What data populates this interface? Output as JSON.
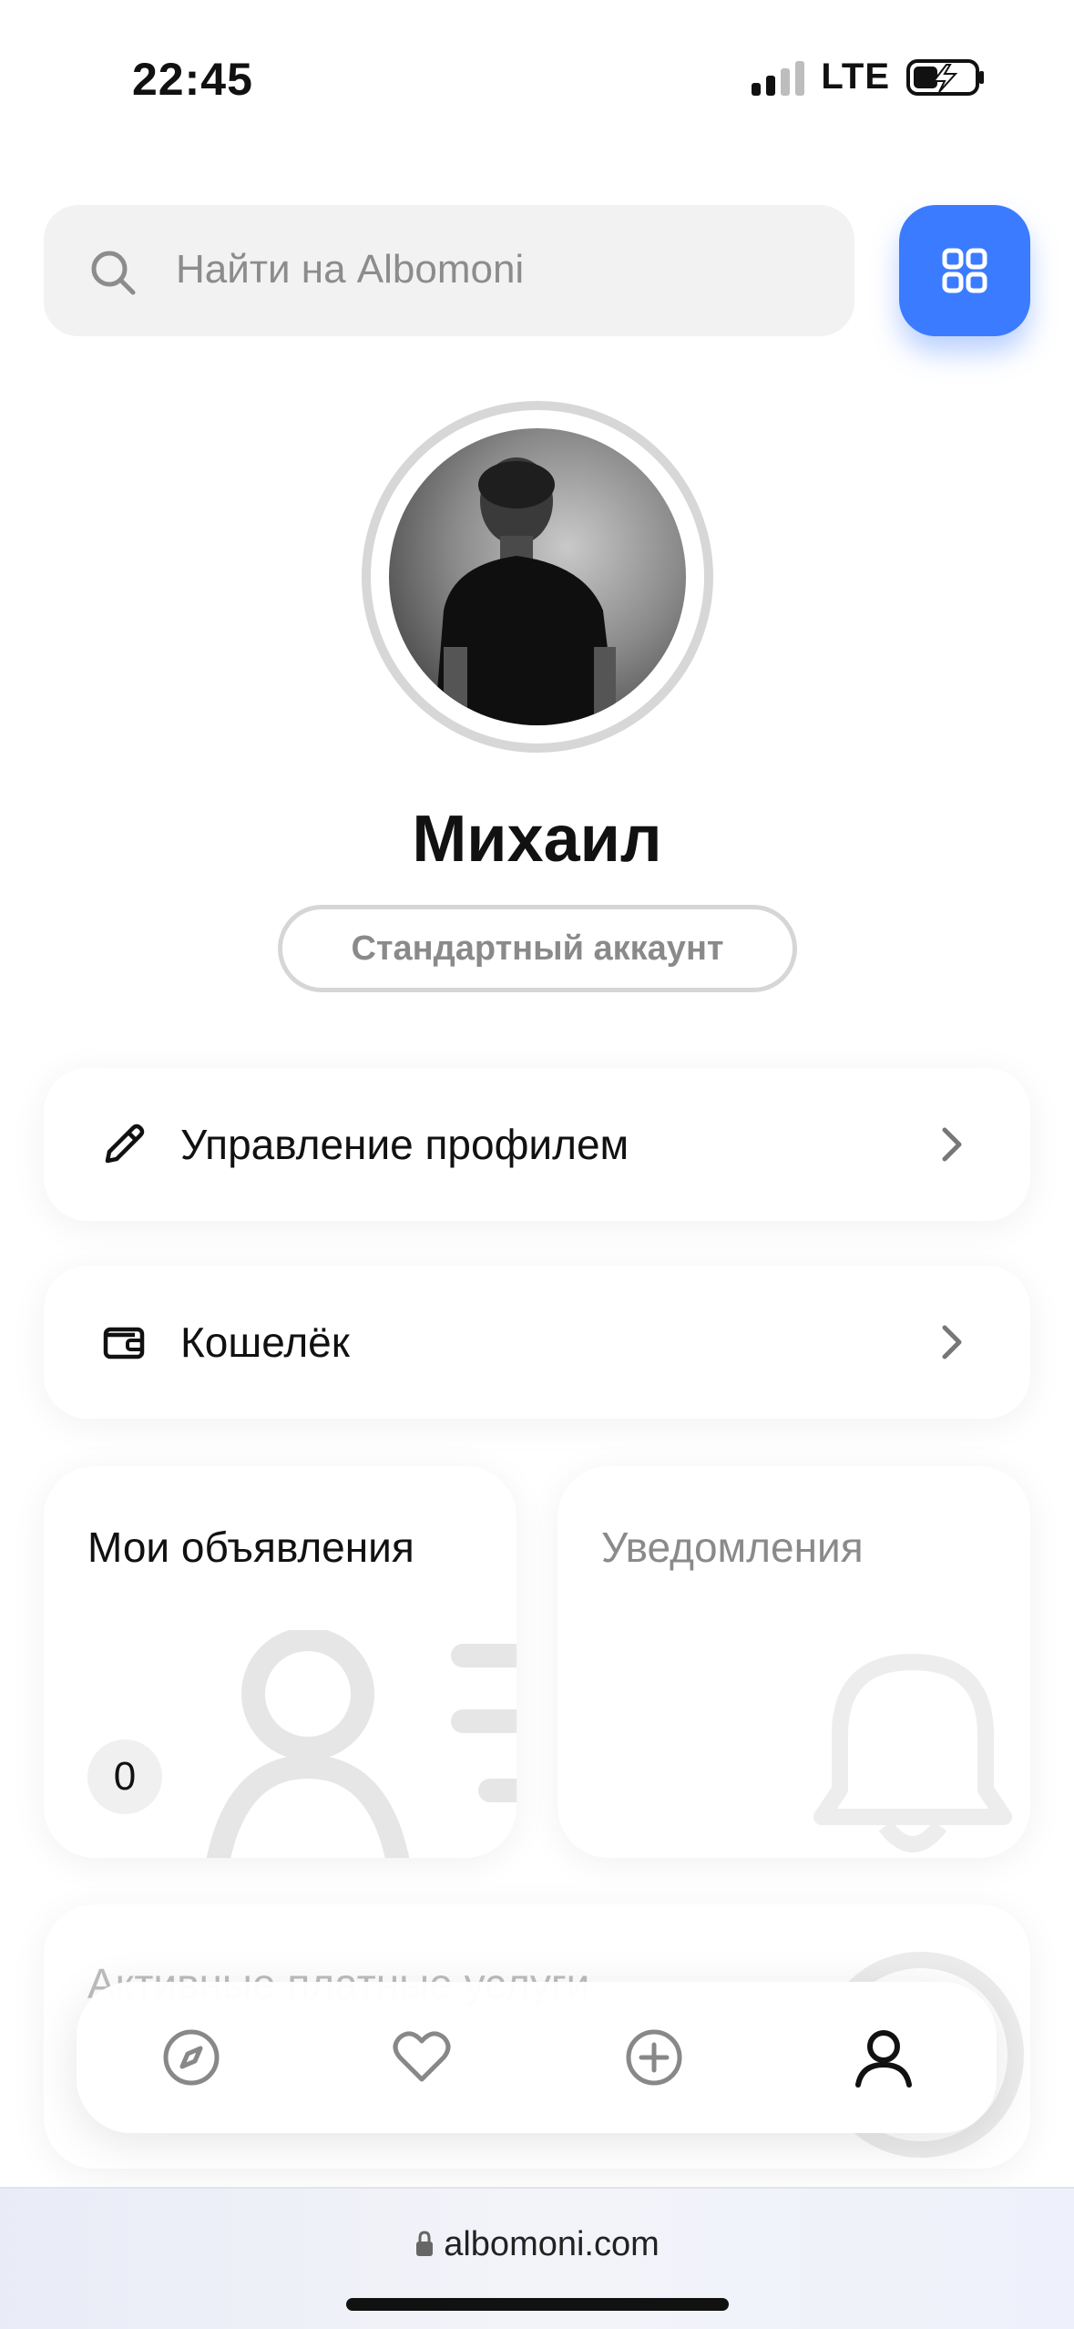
{
  "status": {
    "time": "22:45",
    "network": "LTE"
  },
  "search": {
    "placeholder": "Найти на Albomoni"
  },
  "profile": {
    "name": "Михаил",
    "account_type": "Стандартный аккаунт"
  },
  "menu": [
    {
      "label": "Управление профилем",
      "icon": "pencil-icon"
    },
    {
      "label": "Кошелёк",
      "icon": "wallet-icon"
    }
  ],
  "tiles": {
    "listings": {
      "title": "Мои объявления",
      "count": "0"
    },
    "notifications": {
      "title": "Уведомления"
    }
  },
  "services": {
    "title": "Активные платные услуги"
  },
  "nav": [
    {
      "name": "explore",
      "icon": "compass-icon"
    },
    {
      "name": "favorites",
      "icon": "heart-icon"
    },
    {
      "name": "add",
      "icon": "plus-circle-icon"
    },
    {
      "name": "profile",
      "icon": "user-icon",
      "active": true
    }
  ],
  "browser": {
    "url": "albomoni.com"
  },
  "colors": {
    "accent": "#3b7bff",
    "muted": "#8a8a8a"
  }
}
